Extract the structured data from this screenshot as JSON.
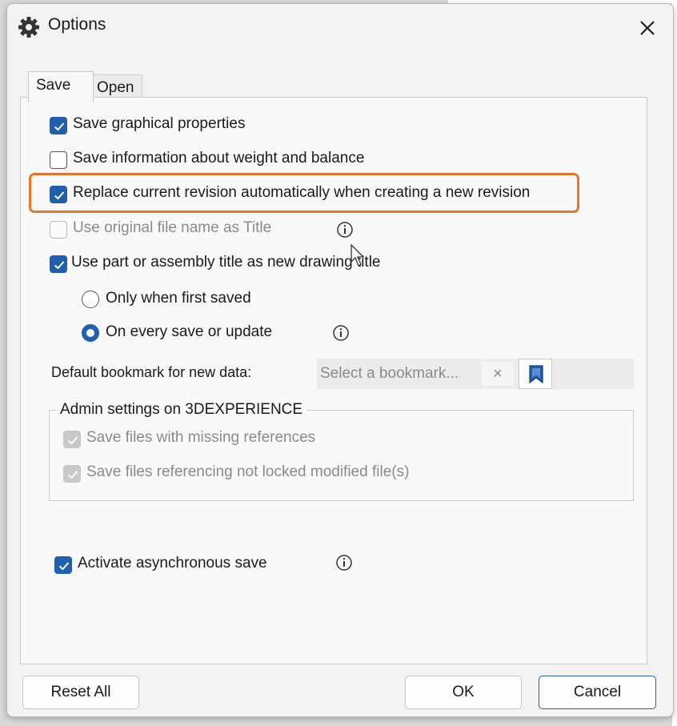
{
  "window": {
    "title": "Options",
    "title_icon": "gear-icon",
    "close_icon": "close-icon"
  },
  "tabs": [
    {
      "label": "Save",
      "active": true
    },
    {
      "label": "Open",
      "active": false
    }
  ],
  "save": {
    "options": [
      {
        "label": "Save graphical properties",
        "checked": true,
        "enabled": true
      },
      {
        "label": "Save information about weight and balance",
        "checked": false,
        "enabled": true
      },
      {
        "label": "Replace current revision automatically when creating a new revision",
        "checked": true,
        "enabled": true,
        "highlighted": true
      },
      {
        "label": "Use original file name as Title",
        "checked": false,
        "enabled": false,
        "info": true
      },
      {
        "label": "Use part or assembly title as new drawing title",
        "checked": true,
        "enabled": true
      }
    ],
    "title_mode": [
      {
        "label": "Only when first saved",
        "selected": false
      },
      {
        "label": "On every save or update",
        "selected": true,
        "info": true
      }
    ],
    "bookmark": {
      "label": "Default bookmark for new data:",
      "placeholder": "Select a bookmark...",
      "clear": "×"
    },
    "admin": {
      "legend": "Admin settings on 3DEXPERIENCE",
      "items": [
        {
          "label": "Save files with missing references",
          "checked": true,
          "enabled": false
        },
        {
          "label": "Save files referencing not locked modified file(s)",
          "checked": true,
          "enabled": false
        }
      ]
    },
    "async": {
      "label": "Activate asynchronous save",
      "checked": true,
      "info": true
    }
  },
  "footer": {
    "reset": "Reset All",
    "ok": "OK",
    "cancel": "Cancel"
  },
  "colors": {
    "accent": "#1f5fad",
    "highlight": "#e8762a",
    "disabled_text": "#8a8a8a"
  }
}
